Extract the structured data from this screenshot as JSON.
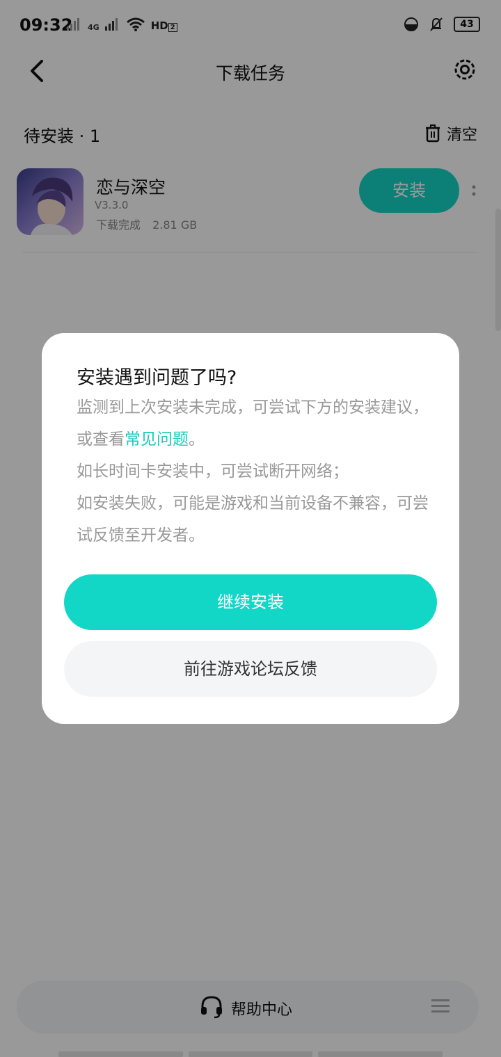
{
  "status_bar": {
    "time": "09:32",
    "network_label": "4G",
    "hd_label": "HD",
    "hd_sim": "2",
    "battery": "43"
  },
  "header": {
    "title": "下载任务",
    "back_icon": "back-arrow-icon",
    "settings_icon": "gear-icon"
  },
  "pending": {
    "header": "待安装 · 1",
    "clear_label": "清空"
  },
  "tasks": [
    {
      "name": "恋与深空",
      "version": "V3.3.0",
      "status": "下载完成",
      "size": "2.81 GB",
      "action": "安装"
    }
  ],
  "dialog": {
    "title": "安装遇到问题了吗?",
    "body_1_prefix": "监测到上次安装未完成，可尝试下方的安装建议，或查看",
    "body_1_link": "常见问题",
    "body_1_suffix": "。",
    "body_2": "如长时间卡安装中，可尝试断开网络；",
    "body_3": "如安装失败，可能是游戏和当前设备不兼容，可尝试反馈至开发者。",
    "primary": "继续安装",
    "secondary": "前往游戏论坛反馈"
  },
  "footer": {
    "help": "帮助中心"
  },
  "colors": {
    "accent": "#12D6C6",
    "overlay": "rgba(0,0,0,0.40)"
  }
}
